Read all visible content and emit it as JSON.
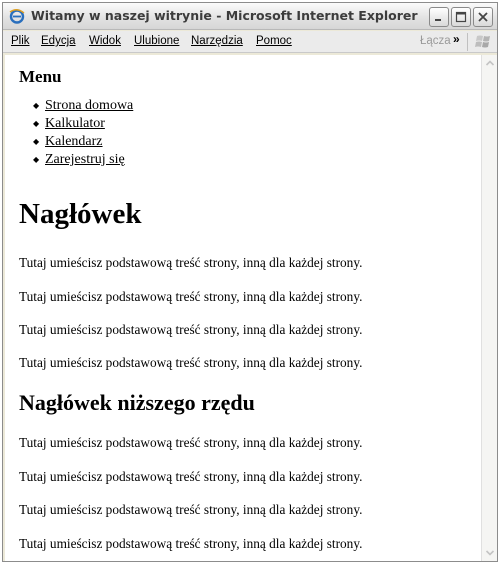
{
  "window": {
    "title": "Witamy w naszej witrynie - Microsoft Internet Explorer"
  },
  "menubar": {
    "items": [
      "Plik",
      "Edycja",
      "Widok",
      "Ulubione",
      "Narzędzia",
      "Pomoc"
    ],
    "links_label": "Łącza",
    "links_chevron": "»"
  },
  "page": {
    "menu_heading": "Menu",
    "nav_links": [
      "Strona domowa",
      "Kalkulator",
      "Kalendarz",
      "Zarejestruj się"
    ],
    "heading": "Nagłówek",
    "subheading": "Nagłówek niższego rzędu",
    "paragraphs": [
      "Tutaj umieścisz podstawową treść strony, inną dla każdej strony.",
      "Tutaj umieścisz podstawową treść strony, inną dla każdej strony.",
      "Tutaj umieścisz podstawową treść strony, inną dla każdej strony.",
      "Tutaj umieścisz podstawową treść strony, inną dla każdej strony.",
      "Tutaj umieścisz podstawową treść strony, inną dla każdej strony.",
      "Tutaj umieścisz podstawową treść strony, inną dla każdej strony.",
      "Tutaj umieścisz podstawową treść strony, inną dla każdej strony.",
      "Tutaj umieścisz podstawową treść strony, inną dla każdej strony."
    ]
  },
  "icons": {
    "app": "internet-explorer-icon",
    "minimize": "minimize-icon",
    "maximize": "maximize-icon",
    "close": "close-icon",
    "windows_logo": "windows-logo-icon",
    "scroll_up": "scroll-up-arrow-icon",
    "scroll_down": "scroll-down-arrow-icon"
  },
  "colors": {
    "titlebar_text": "#3c3c3c",
    "menubar_bg": "#ebebeb",
    "content_bg": "#ffffff",
    "link_text": "#000000"
  }
}
